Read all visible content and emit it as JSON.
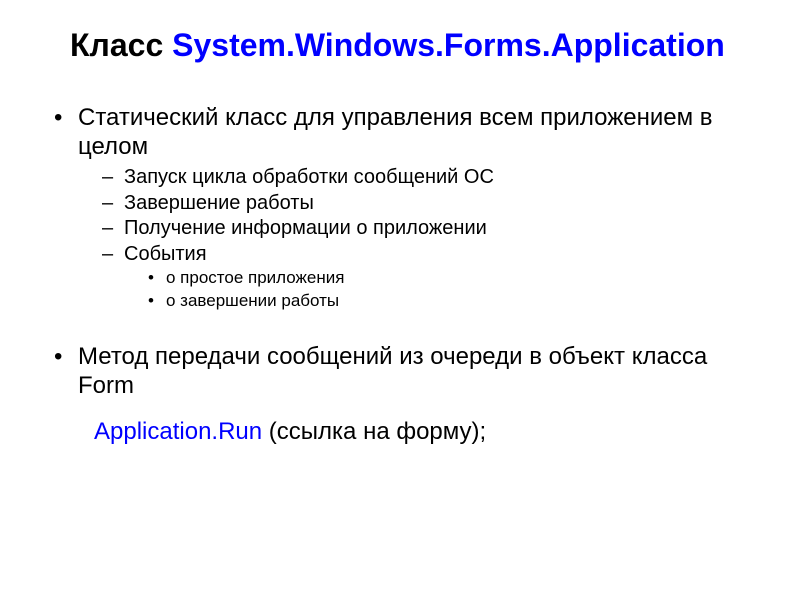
{
  "title": {
    "prefix": "Класс ",
    "classname": "System.Windows.Forms.Application"
  },
  "bullets": {
    "l1": [
      "Статический класс для управления всем приложением в целом",
      "Метод передачи сообщений из очереди в объект класса Form"
    ],
    "l2": [
      "Запуск цикла обработки сообщений ОС",
      "Завершение работы",
      "Получение информации о приложении",
      "События"
    ],
    "l3": [
      "о простое приложения",
      "о завершении работы"
    ]
  },
  "code": {
    "call": "Application.Run ",
    "arg": "(ссылка на форму);"
  }
}
